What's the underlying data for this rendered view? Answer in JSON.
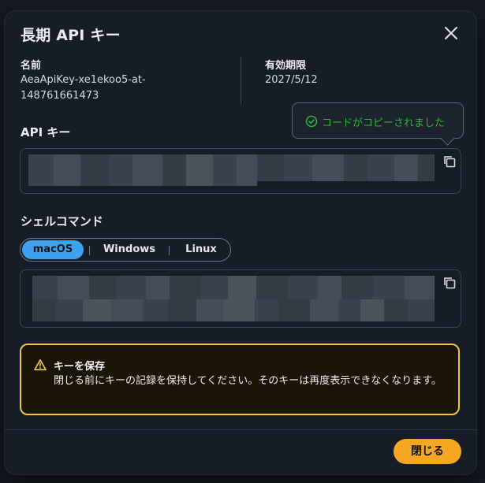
{
  "modal": {
    "title": "長期 API キー",
    "close_label": "close"
  },
  "meta": {
    "name_label": "名前",
    "name_value": "AeaApiKey-xe1ekoo5-at-148761661473",
    "expiry_label": "有効期限",
    "expiry_value": "2027/5/12"
  },
  "api_key": {
    "label": "API キー",
    "redacted": true
  },
  "tooltip": {
    "text": "コードがコピーされました",
    "color": "#2bb534"
  },
  "shell": {
    "label": "シェルコマンド",
    "tabs": [
      {
        "label": "macOS",
        "selected": true
      },
      {
        "label": "Windows",
        "selected": false
      },
      {
        "label": "Linux",
        "selected": false
      }
    ],
    "redacted": true
  },
  "alert": {
    "title": "キーを保存",
    "body": "閉じる前にキーの記録を保持してください。そのキーは再度表示できなくなります。",
    "border_color": "#f1c44d"
  },
  "footer": {
    "close_button": "閉じる",
    "accent": "#f5a623"
  }
}
